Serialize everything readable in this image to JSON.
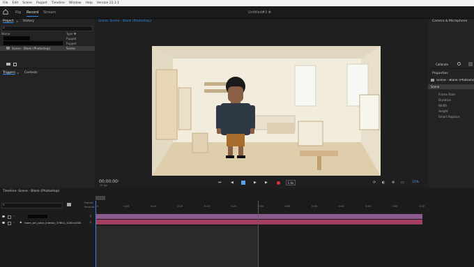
{
  "menu": [
    "File",
    "Edit",
    "Scene",
    "Puppet",
    "Timeline",
    "Window",
    "Help",
    "Version 22.1.1"
  ],
  "modes": [
    "Rig",
    "Record",
    "Stream"
  ],
  "active_mode": "Record",
  "doc_title": "Untitled#3 ✻",
  "left_panel": {
    "tabs": [
      "Project",
      "History"
    ],
    "columns": {
      "name": "Name",
      "type": "Type ▼"
    },
    "rows": [
      {
        "name": "",
        "type": "Puppet"
      },
      {
        "name": "",
        "type": "Puppet"
      },
      {
        "name": "Scene - Blank (Photoshop)",
        "type": "Scene"
      }
    ],
    "lower_tabs": [
      "Triggers",
      "Controls"
    ]
  },
  "scene_panel": {
    "title": "Scene: Scene - Blank (Photoshop)",
    "timecode": "00:00:00",
    "fps": "24 fps",
    "speed": "1.0x",
    "zoom": "15%"
  },
  "right_panel": {
    "camera_title": "Camera & Microphone",
    "calibrate": "Calibrate",
    "properties_title": "Properties",
    "scene_item": "Scene - Blank (Photoshop)",
    "section": "Scene",
    "props": [
      "Frame Rate",
      "Duration",
      "Width",
      "Height",
      "Smart Replace"
    ]
  },
  "timeline": {
    "title": "Timeline: Scene - Blank (Photoshop)",
    "ruler_labels": [
      "Frames",
      "Seconds"
    ],
    "ticks": [
      "0",
      "0:05",
      "0:10",
      "0:15",
      "0:20",
      "0:25",
      "0:30",
      "0:35",
      "0:40",
      "0:45",
      "0:50",
      "0:55",
      "1:00"
    ],
    "rows": [
      {
        "name": ""
      },
      {
        "name": "room_art_color_interior_37654_1000x1000"
      }
    ]
  },
  "colors": {
    "accent": "#2d8ceb",
    "track_purple": "#8b5a8e",
    "track_pink": "#a33e63",
    "record_red": "#e0303d"
  }
}
